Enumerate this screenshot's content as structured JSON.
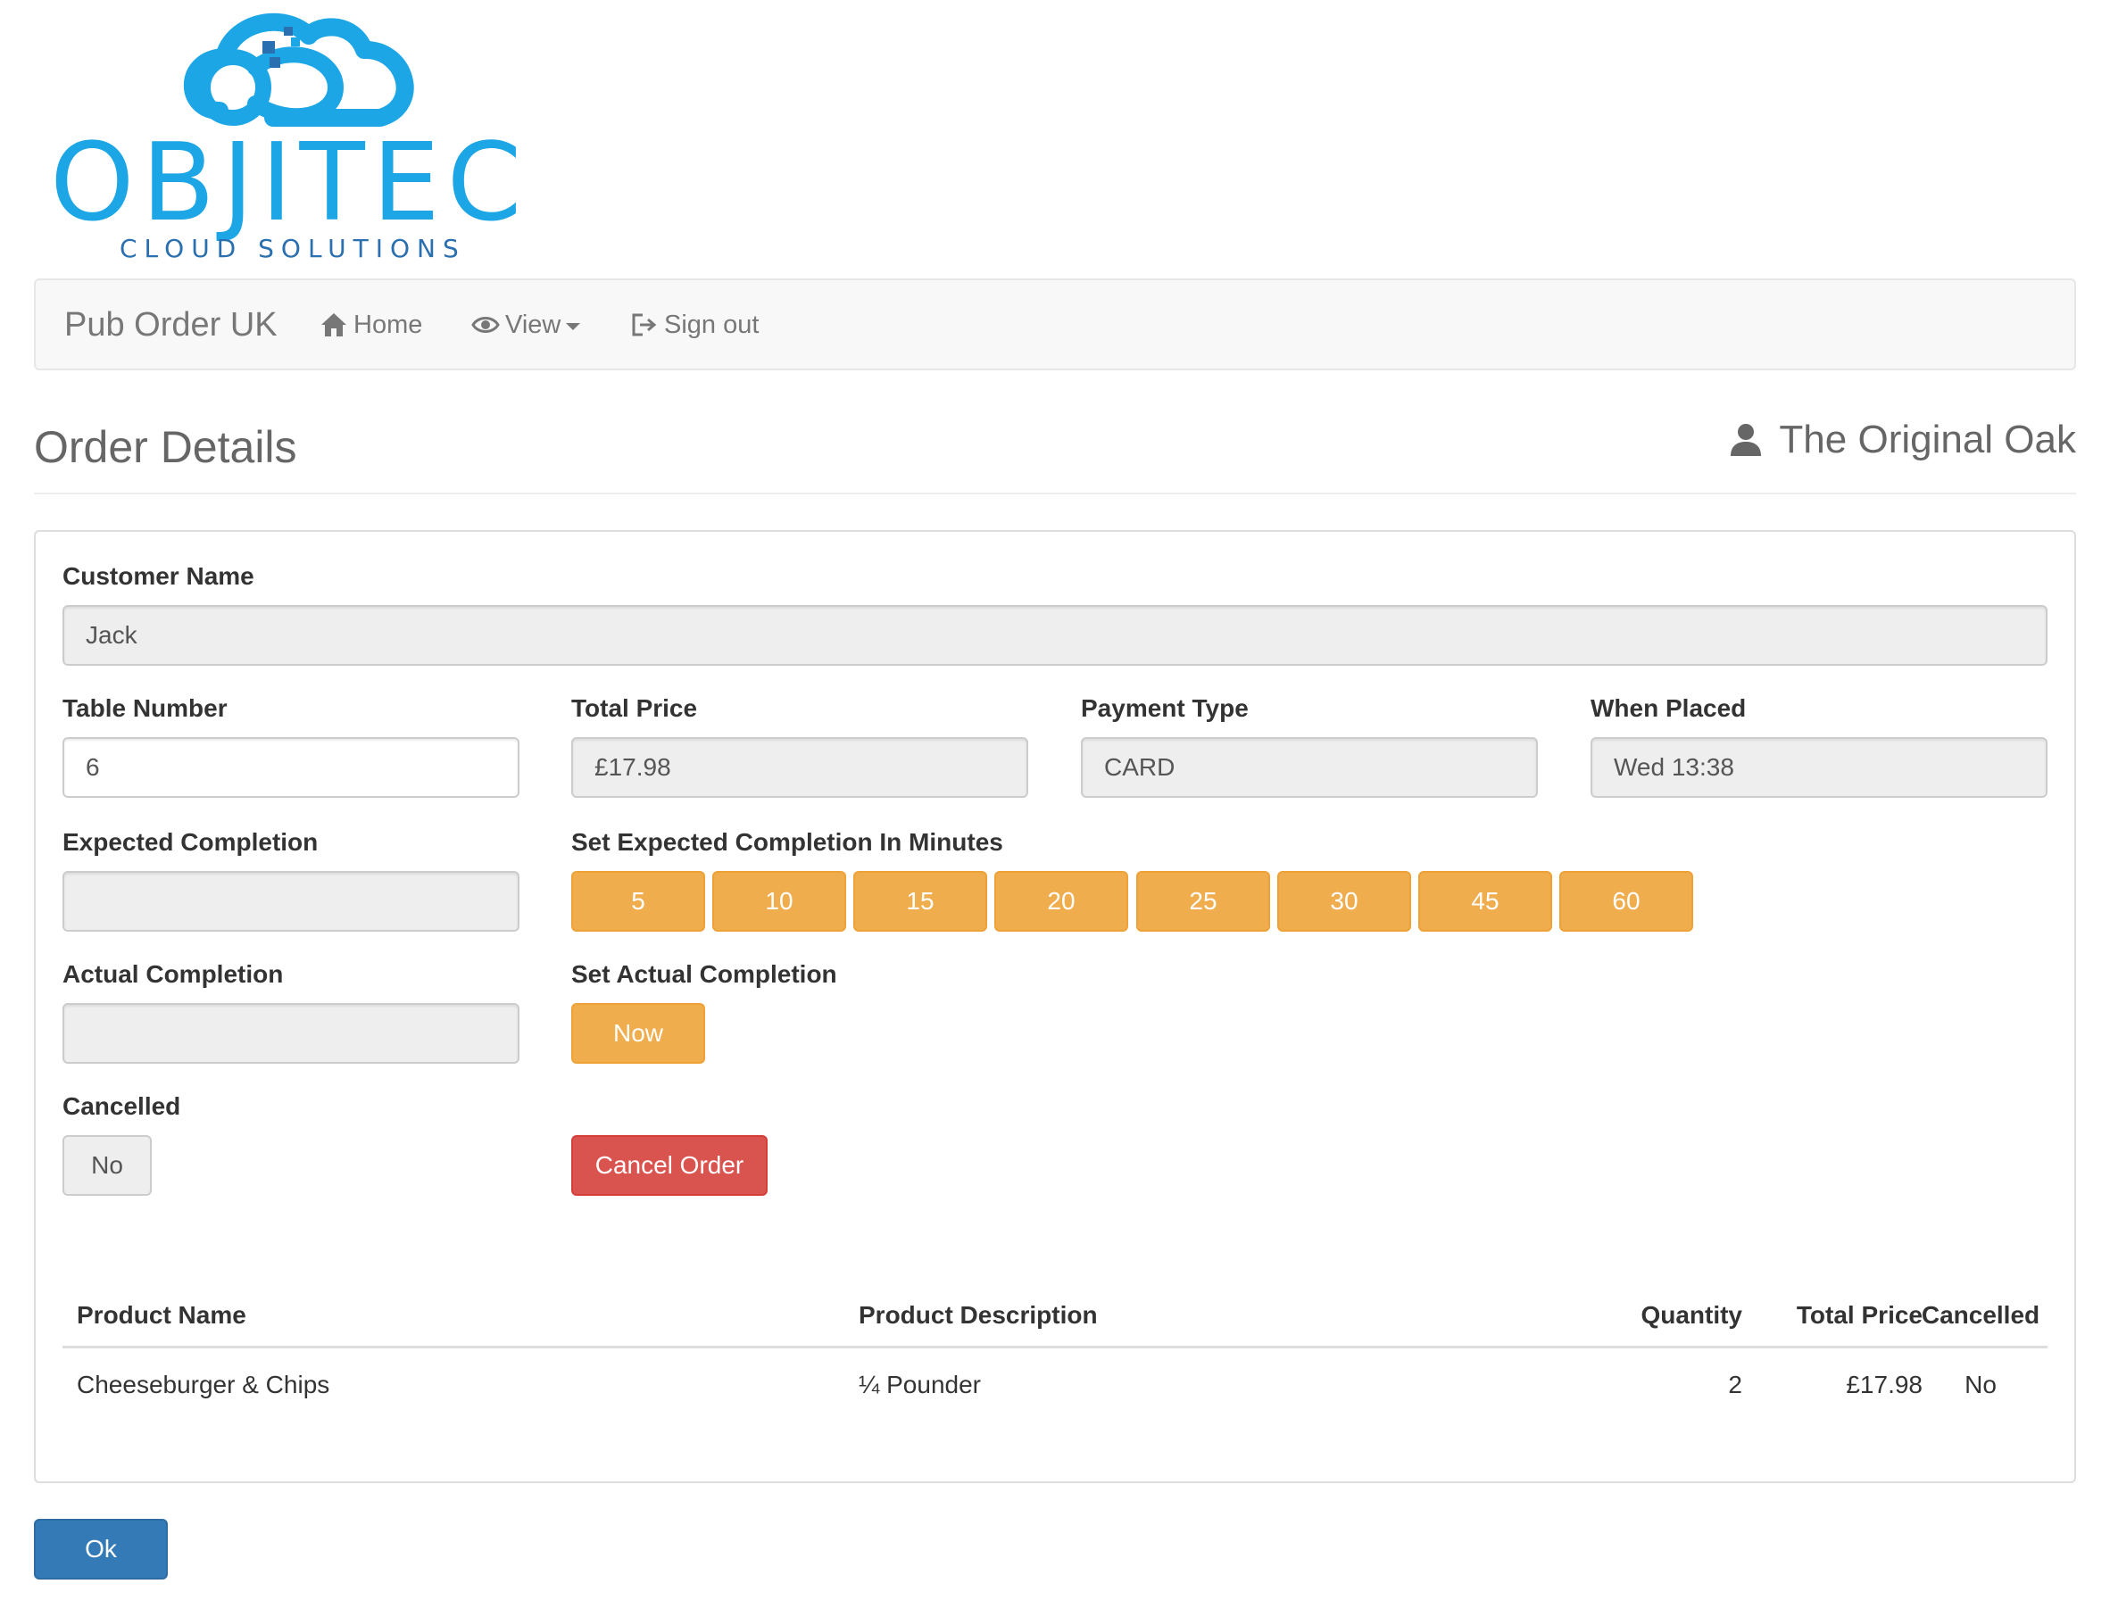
{
  "logo": {
    "name": "OBJITEC",
    "tagline": "CLOUD SOLUTIONS",
    "colors": {
      "primary": "#1da6e6",
      "secondary": "#2a6fb0"
    }
  },
  "navbar": {
    "brand": "Pub Order UK",
    "items": [
      {
        "label": "Home",
        "icon": "home-icon"
      },
      {
        "label": "View",
        "icon": "eye-icon",
        "dropdown": true
      },
      {
        "label": "Sign out",
        "icon": "sign-out-icon"
      }
    ]
  },
  "header": {
    "title": "Order Details",
    "venue": "The Original Oak",
    "venue_icon": "user-icon"
  },
  "form": {
    "customer_name": {
      "label": "Customer Name",
      "value": "Jack"
    },
    "table_number": {
      "label": "Table Number",
      "value": "6"
    },
    "total_price": {
      "label": "Total Price",
      "value": "£17.98"
    },
    "payment_type": {
      "label": "Payment Type",
      "value": "CARD"
    },
    "when_placed": {
      "label": "When Placed",
      "value": "Wed 13:38"
    },
    "expected_completion": {
      "label": "Expected Completion",
      "value": ""
    },
    "set_expected": {
      "label": "Set Expected Completion In Minutes",
      "options": [
        "5",
        "10",
        "15",
        "20",
        "25",
        "30",
        "45",
        "60"
      ]
    },
    "actual_completion": {
      "label": "Actual Completion",
      "value": ""
    },
    "set_actual": {
      "label": "Set Actual Completion",
      "button": "Now"
    },
    "cancelled": {
      "label": "Cancelled",
      "value": "No"
    },
    "cancel_button": "Cancel Order"
  },
  "table": {
    "columns": [
      "Product Name",
      "Product Description",
      "Quantity",
      "Total Price",
      "Cancelled"
    ],
    "rows": [
      [
        "Cheeseburger & Chips",
        "¼ Pounder",
        "2",
        "£17.98",
        "No"
      ]
    ]
  },
  "ok_button": "Ok",
  "colors": {
    "warning": "#f0ad4e",
    "danger": "#d9534f",
    "primary": "#337ab7"
  }
}
